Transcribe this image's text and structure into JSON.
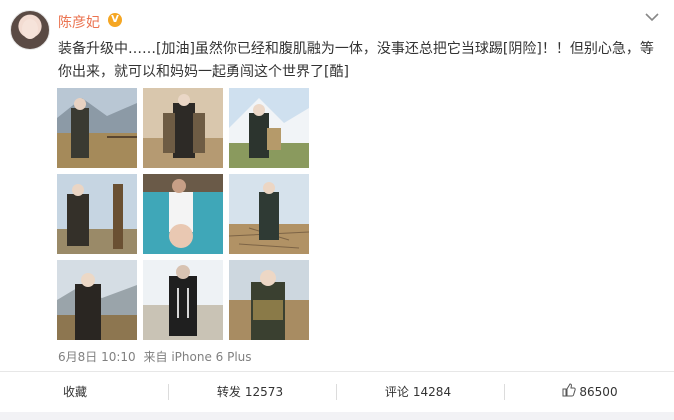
{
  "header": {
    "username": "陈彦妃",
    "verified_badge": "V",
    "menu_icon": "chevron-down-icon"
  },
  "post": {
    "text": "装备升级中……[加油]虽然你已经和腹肌融为一体，没事还总把它当球踢[阴险]！！但别心急，等你出来，就可以和妈妈一起勇闯这个世界了[酷]",
    "photos": [
      {
        "scene": "mountain-fence"
      },
      {
        "scene": "sepia-lace"
      },
      {
        "scene": "snowy-peak"
      },
      {
        "scene": "wooden-post"
      },
      {
        "scene": "turquoise-lake"
      },
      {
        "scene": "cracked-earth"
      },
      {
        "scene": "dark-valley"
      },
      {
        "scene": "bright-sky"
      },
      {
        "scene": "ground-closeup"
      }
    ]
  },
  "meta": {
    "date": "6月8日 10:10",
    "source": "来自 iPhone 6 Plus"
  },
  "actions": {
    "favorite_label": "收藏",
    "repost_label": "转发",
    "repost_count": "12573",
    "comment_label": "评论",
    "comment_count": "14284",
    "like_count": "86500"
  },
  "colors": {
    "username": "#eb7350",
    "badge": "#f5a623",
    "text": "#333333",
    "meta": "#808080"
  }
}
